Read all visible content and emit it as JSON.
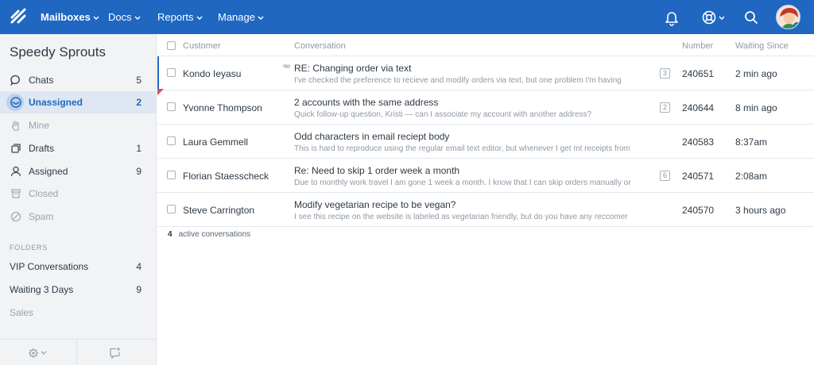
{
  "nav": {
    "mailboxes": "Mailboxes",
    "docs": "Docs",
    "reports": "Reports",
    "manage": "Manage"
  },
  "sidebar": {
    "mailbox_name": "Speedy Sprouts",
    "items": [
      {
        "label": "Chats",
        "count": "5",
        "icon": "chat-bubble-icon"
      },
      {
        "label": "Unassigned",
        "count": "2",
        "icon": "inbox-icon"
      },
      {
        "label": "Mine",
        "count": "",
        "icon": "hand-icon"
      },
      {
        "label": "Drafts",
        "count": "1",
        "icon": "drafts-icon"
      },
      {
        "label": "Assigned",
        "count": "9",
        "icon": "person-icon"
      },
      {
        "label": "Closed",
        "count": "",
        "icon": "archive-icon"
      },
      {
        "label": "Spam",
        "count": "",
        "icon": "spam-icon"
      }
    ],
    "folders_heading": "FOLDERS",
    "folders": [
      {
        "label": "VIP Conversations",
        "count": "4"
      },
      {
        "label": "Waiting 3 Days",
        "count": "9"
      },
      {
        "label": "Sales",
        "count": ""
      }
    ]
  },
  "table": {
    "headers": {
      "customer": "Customer",
      "conversation": "Conversation",
      "number": "Number",
      "waiting": "Waiting Since"
    },
    "rows": [
      {
        "customer": "Kondo Ieyasu",
        "subject": "RE: Changing order via text",
        "preview": "I've checked the preference to recieve and modify orders via text, but one problem I'm having",
        "thread_count": "3",
        "number": "240651",
        "waiting": "2 min ago"
      },
      {
        "customer": "Yvonne Thompson",
        "subject": "2 accounts with the same address",
        "preview": "Quick follow-up question, Kristi — can I associate my account with another address?",
        "thread_count": "2",
        "number": "240644",
        "waiting": "8 min ago"
      },
      {
        "customer": "Laura Gemmell",
        "subject": "Odd characters in email reciept body",
        "preview": "This is hard to reproduce using the regular email text editor, but whenever I get mt receipts from",
        "thread_count": "",
        "number": "240583",
        "waiting": "8:37am"
      },
      {
        "customer": "Florian Staesscheck",
        "subject": "Re: Need to skip 1 order week a month",
        "preview": "Due to monthly work travel I am gone 1 week a month. I know that I can skip orders manually or",
        "thread_count": "6",
        "number": "240571",
        "waiting": "2:08am"
      },
      {
        "customer": "Steve Carrington",
        "subject": "Modify vegetarian recipe to be vegan?",
        "preview": "I see this recipe on the website is labeled as vegetarian friendly, but do you have any reccomer",
        "thread_count": "",
        "number": "240570",
        "waiting": "3 hours ago"
      }
    ],
    "footer_count": "4",
    "footer_label": "active conversations"
  },
  "colors": {
    "brand": "#1f67c1",
    "sidebar_bg": "#f1f3f5",
    "flag": "#e5484d",
    "online": "#36b37e"
  }
}
